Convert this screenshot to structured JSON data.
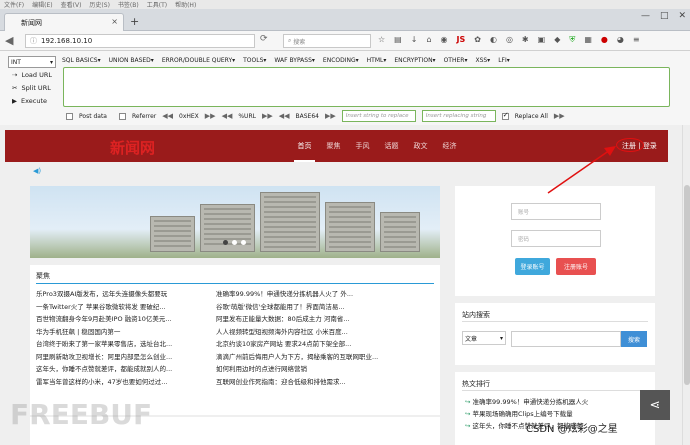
{
  "menubar": [
    "文件(F)",
    "编辑(E)",
    "查看(V)",
    "历史(S)",
    "书签(B)",
    "工具(T)",
    "帮助(H)"
  ],
  "tab": {
    "title": "新闻网",
    "close": "×",
    "new": "+"
  },
  "window": {
    "min": "—",
    "max": "□",
    "close": "✕"
  },
  "nav": {
    "url": "192.168.10.10",
    "search_placeholder": "搜索",
    "zoom": "ⓘ"
  },
  "hackbar": {
    "select": "INT",
    "menu": [
      "SQL BASICS▾",
      "UNION BASED▾",
      "ERROR/DOUBLE QUERY▾",
      "TOOLS▾",
      "WAF BYPASS▾",
      "ENCODING▾",
      "HTML▾",
      "ENCRYPTION▾",
      "OTHER▾",
      "XSS▾",
      "LFI▾"
    ],
    "actions": [
      "Load URL",
      "Split URL",
      "Execute"
    ],
    "post_data": "Post data",
    "referrer": "Referrer",
    "hex": "0xHEX",
    "url": "%URL",
    "base64": "BASE64",
    "insert_replace_placeholder": "Insert string to replace",
    "insert_replacing_placeholder": "Insert replacing string",
    "replace_all": "Replace All"
  },
  "site": {
    "logo": "新闻网",
    "nav": [
      "首页",
      "聚焦",
      "手风",
      "话题",
      "政文",
      "经济"
    ],
    "register": "注册",
    "sep": " | ",
    "login": "登录",
    "section_title": "聚焦",
    "news_left": [
      "乐Pro3双摄AI版发布，远年头连摄像头都要玩",
      "一条Twitter火了 苹果谷歌微软将发 要破纪...",
      "百世物流翻身今年9月赴美IPO 融资10亿美元...",
      "华为手机狂飙 | 稳固国内第一",
      "台湾终于盼来了第一家苹果零售店，选址台北...",
      "阿里刷新助攻卫视增长：阿里内部是怎么创业...",
      "这年头，你睡不点赞就差评，都能成就别人的...",
      "雷军当年曾这样的小米，47岁也要如何过过..."
    ],
    "news_right": [
      "准确率99.99%！申通快递分拣机器人火了 外...",
      "谷歌'萌版'微信'全球都能用了！界面简洁易...",
      "阿里发布正能量大数据：80后成主力 河南省...",
      "人人视频转型短视频海外内容社区 小米百度...",
      "北京约谈10家房产网站 要求24点前下架全部...",
      "滴滴广州前后悔用户人为下方，揭秘乘客的互联网职业...",
      "如何利用边时的点进行网络营销",
      "互联网创业作死指南：迎合低级和排他需求..."
    ],
    "username_placeholder": "账号",
    "password_placeholder": "密码",
    "login_btn": "登录账号",
    "register_btn": "注册账号",
    "search_title": "站内搜索",
    "search_select": "文章",
    "search_btn": "搜索",
    "hot_title": "热文排行",
    "hot": [
      "准确率99.99%！申通快递分拣机器人火",
      "苹果现场确确用Clips上编号下载量",
      "这年头，你睡不点赞就差评，都能成就..."
    ]
  },
  "watermark": {
    "left": "FREEBUF",
    "right": "CSDN @炫彩@之星"
  }
}
